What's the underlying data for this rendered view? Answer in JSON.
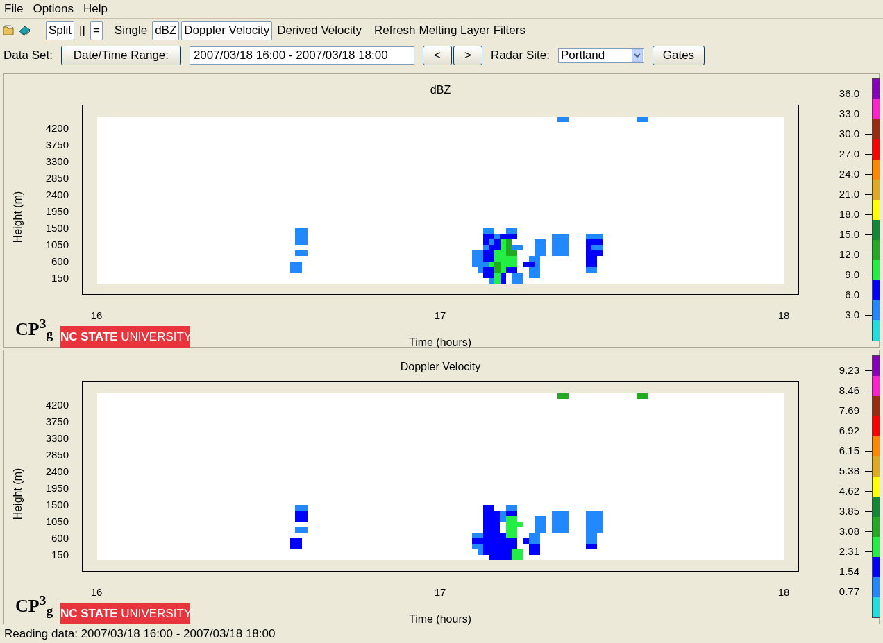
{
  "menu": [
    "File",
    "Options",
    "Help"
  ],
  "toolbar": {
    "view_toggles": [
      {
        "label": "Split",
        "selected": true
      },
      {
        "label": "||",
        "selected": false
      },
      {
        "label": "=",
        "selected": true
      },
      {
        "label": "Single",
        "selected": false
      },
      {
        "label": "dBZ",
        "selected": true
      },
      {
        "label": "Doppler Velocity",
        "selected": true
      },
      {
        "label": "Derived Velocity",
        "selected": false
      }
    ],
    "actions": [
      "Refresh",
      "Melting Layer",
      "Filters"
    ]
  },
  "data_set": {
    "label": "Data Set:",
    "range_button": "Date/Time Range:",
    "range_value": "2007/03/18 16:00 - 2007/03/18 18:00",
    "prev": "<",
    "next": ">",
    "site_label": "Radar Site:",
    "site_value": "Portland",
    "gates_button": "Gates"
  },
  "panels": [
    {
      "title": "dBZ",
      "ylabel": "Height (m)",
      "yticks": [
        "4200",
        "3750",
        "3300",
        "2850",
        "2400",
        "1950",
        "1500",
        "1050",
        "600",
        "150"
      ],
      "xticks": [
        "16",
        "17",
        "18"
      ],
      "xlabel": "Time (hours)",
      "logo": "CP$^{3}$$_{g}$",
      "university": "**NC STATE** UNIVERSITY",
      "colorbar": {
        "segments": [
          {
            "color": "#8800bb"
          },
          {
            "color": "#ff22cc"
          },
          {
            "color": "#992a10"
          },
          {
            "color": "#ff0000"
          },
          {
            "color": "#ff8800"
          },
          {
            "color": "#ddaa22"
          },
          {
            "color": "#ffff00"
          },
          {
            "color": "#118833"
          },
          {
            "color": "#22aa22"
          },
          {
            "color": "#22ee44"
          },
          {
            "color": "#0000ff"
          },
          {
            "color": "#2288ff"
          },
          {
            "color": "#22dddd"
          }
        ],
        "labels": [
          "36.0",
          "33.0",
          "30.0",
          "27.0",
          "24.0",
          "21.0",
          "18.0",
          "15.0",
          "12.0",
          "9.0",
          "6.0",
          "3.0"
        ]
      }
    },
    {
      "title": "Doppler Velocity",
      "ylabel": "Height (m)",
      "yticks": [
        "4200",
        "3750",
        "3300",
        "2850",
        "2400",
        "1950",
        "1500",
        "1050",
        "600",
        "150"
      ],
      "xticks": [
        "16",
        "17",
        "18"
      ],
      "xlabel": "Time (hours)",
      "logo": "CP$^{3}$$_{g}$",
      "university": "**NC STATE** UNIVERSITY",
      "colorbar": {
        "segments": [
          {
            "color": "#8800bb"
          },
          {
            "color": "#ff22cc"
          },
          {
            "color": "#992a10"
          },
          {
            "color": "#ff0000"
          },
          {
            "color": "#ff8800"
          },
          {
            "color": "#ddaa22"
          },
          {
            "color": "#ffff00"
          },
          {
            "color": "#118833"
          },
          {
            "color": "#22aa22"
          },
          {
            "color": "#22ee44"
          },
          {
            "color": "#0000ff"
          },
          {
            "color": "#2288ff"
          },
          {
            "color": "#22dddd"
          }
        ],
        "labels": [
          "9.23",
          "8.46",
          "7.69",
          "6.92",
          "6.15",
          "5.38",
          "4.62",
          "3.85",
          "3.08",
          "2.31",
          "1.54",
          "0.77"
        ]
      }
    }
  ],
  "status": "Reading data: 2007/03/18 16:00 - 2007/03/18 18:00"
}
